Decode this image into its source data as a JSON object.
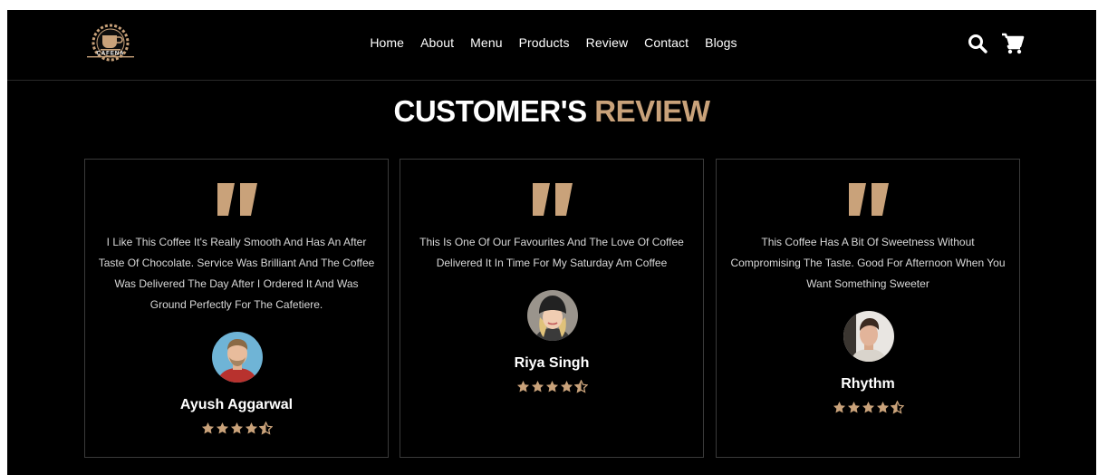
{
  "brand": {
    "logo_text": "CAFENA"
  },
  "nav": {
    "items": [
      "Home",
      "About",
      "Menu",
      "Products",
      "Review",
      "Contact",
      "Blogs"
    ]
  },
  "header_icons": [
    "search-icon",
    "cart-icon"
  ],
  "section": {
    "title_white": "CUSTOMER'S",
    "title_accent": "REVIEW"
  },
  "colors": {
    "accent": "#c9a27a",
    "background": "#000000",
    "text": "#ffffff",
    "muted_text": "#d8d8d8",
    "border": "#3a3a3a"
  },
  "reviews": [
    {
      "text": "I Like This Coffee It's Really Smooth And Has An After Taste Of Chocolate. Service Was Brilliant And The Coffee Was Delivered The Day After I Ordered It And Was Ground Perfectly For The Cafetiere.",
      "name": "Ayush Aggarwal",
      "rating": 4.5
    },
    {
      "text": "This Is One Of Our Favourites And The Love Of Coffee Delivered It In Time For My Saturday Am Coffee",
      "name": "Riya Singh",
      "rating": 4.5
    },
    {
      "text": "This Coffee Has A Bit Of Sweetness Without Compromising The Taste. Good For Afternoon When You Want Something Sweeter",
      "name": "Rhythm",
      "rating": 4.5
    }
  ]
}
